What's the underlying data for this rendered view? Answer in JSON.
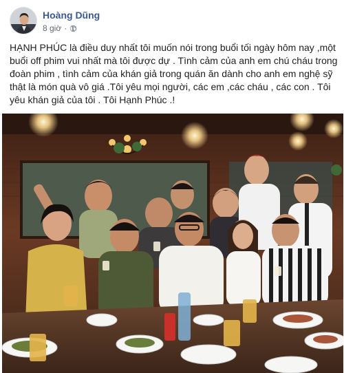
{
  "post": {
    "author_name": "Hoàng Dũng",
    "timestamp": "8 giờ",
    "separator": "·",
    "privacy_icon": "globe-icon",
    "body_text": "HẠNH PHÚC là điều duy nhất tôi muốn nói trong buổi tối ngày hôm nay ,một buổi off phim vui nhất mà tôi được dự . Tình cảm của anh em chú cháu trong đoàn phim , tình cảm của khán giả trong quán ăn dành cho anh em nghệ sỹ thật là món quà vô giá .Tôi yêu mọi người, các em ,các cháu , các con . Tôi yêu khán giả của tôi . Tôi Hạnh Phúc .!"
  },
  "colors": {
    "author_link": "#385898",
    "meta_text": "#616770",
    "body_text": "#1c1e21",
    "photo_wall": "#5a2e1c",
    "photo_light": "#f6d28a"
  }
}
